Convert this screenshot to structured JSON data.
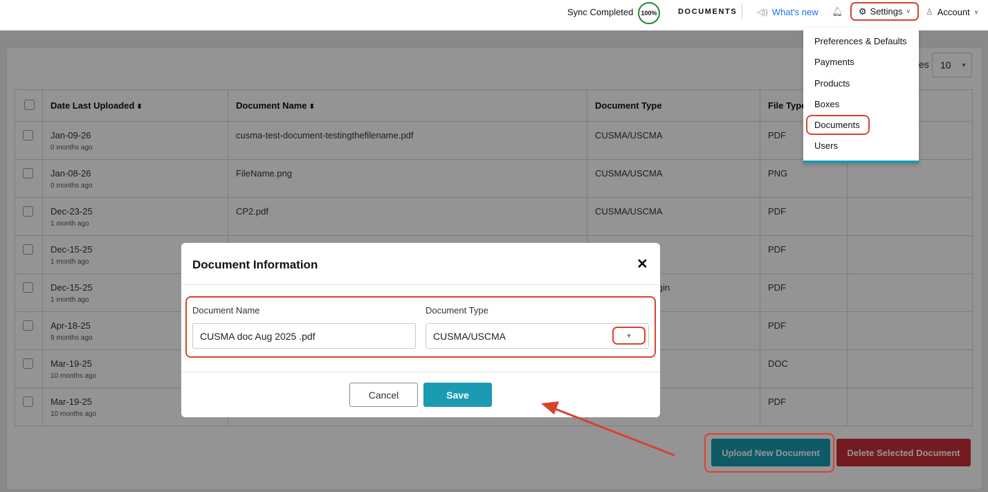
{
  "topbar": {
    "sync_text": "Sync Completed",
    "sync_percent": "100%",
    "section_label": "DOCUMENTS",
    "whats_new": "What's new",
    "settings_label": "Settings",
    "account_label": "Account"
  },
  "settings_menu": {
    "items": [
      "Preferences & Defaults",
      "Payments",
      "Products",
      "Boxes",
      "Documents",
      "Users"
    ]
  },
  "table": {
    "entries_label": "es",
    "entries_value": "10",
    "headers": [
      "Date Last Uploaded",
      "Document Name",
      "Document Type",
      "File Type"
    ],
    "rows": [
      {
        "date": "Jan-09-26",
        "ago": "0 months ago",
        "name": "cusma-test-document-testingthefilename.pdf",
        "type": "CUSMA/USCMA",
        "file": "PDF"
      },
      {
        "date": "Jan-08-26",
        "ago": "0 months ago",
        "name": "FileName.png",
        "type": "CUSMA/USCMA",
        "file": "PNG"
      },
      {
        "date": "Dec-23-25",
        "ago": "1 month ago",
        "name": "CP2.pdf",
        "type": "CUSMA/USCMA",
        "file": "PDF"
      },
      {
        "date": "Dec-15-25",
        "ago": "1 month ago",
        "name": "",
        "type": "",
        "file": "PDF"
      },
      {
        "date": "Dec-15-25",
        "ago": "1 month ago",
        "name": "",
        "type": "igin",
        "file": "PDF"
      },
      {
        "date": "Apr-18-25",
        "ago": "9 months ago",
        "name": "",
        "type": "",
        "file": "PDF"
      },
      {
        "date": "Mar-19-25",
        "ago": "10 months ago",
        "name": "",
        "type": "",
        "file": "DOC"
      },
      {
        "date": "Mar-19-25",
        "ago": "10 months ago",
        "name": "",
        "type": "",
        "file": "PDF"
      }
    ]
  },
  "actions": {
    "upload": "Upload New Document",
    "delete": "Delete Selected Document"
  },
  "modal": {
    "title": "Document Information",
    "name_label": "Document Name",
    "name_value": "CUSMA doc Aug 2025 .pdf",
    "type_label": "Document Type",
    "type_value": "CUSMA/USCMA",
    "cancel": "Cancel",
    "save": "Save"
  },
  "colors": {
    "accent": "#1a9bb1",
    "danger": "#c8303a",
    "annotation": "#d9412e",
    "sync_ring": "#1e8a2f"
  }
}
